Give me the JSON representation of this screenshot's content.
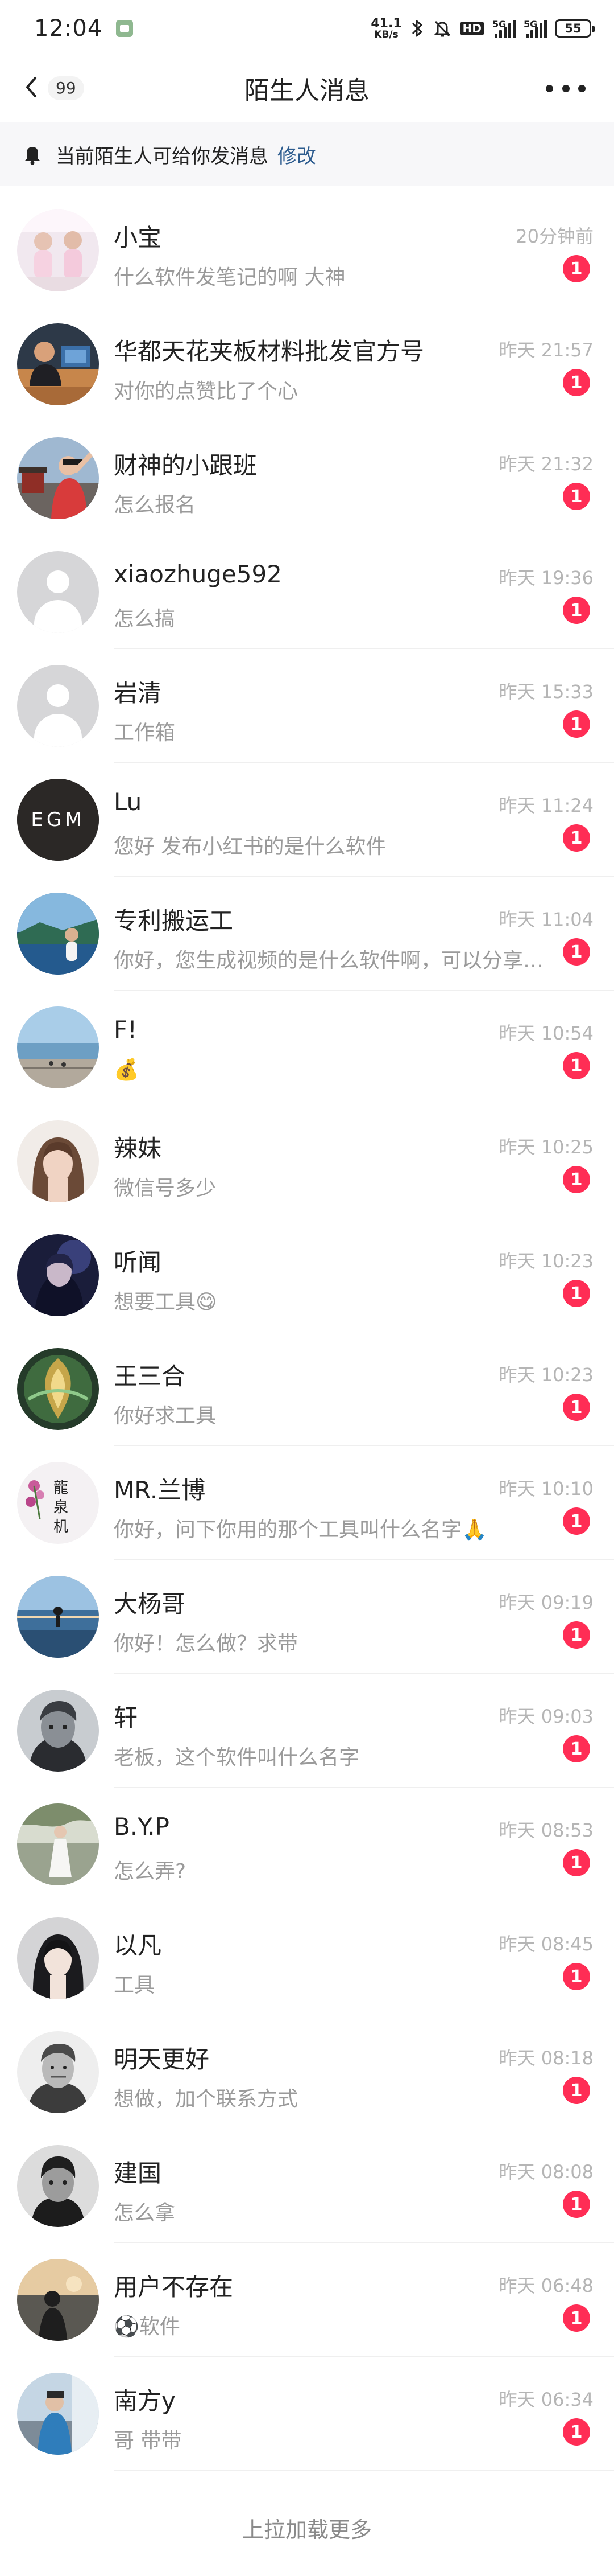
{
  "status_bar": {
    "time": "12:04",
    "net_speed_value": "41.1",
    "net_speed_unit": "KB/s",
    "hd_label": "HD",
    "signal_1_label": "5G",
    "signal_2_label": "5G",
    "battery": "55"
  },
  "nav": {
    "unread_count": "99",
    "title": "陌生人消息"
  },
  "notice": {
    "text": "当前陌生人可给你发消息",
    "link": "修改"
  },
  "messages": [
    {
      "name": "小宝",
      "preview": "什么软件发笔记的啊 大神",
      "time": "20分钟前",
      "badge": "1",
      "avatar": "av1"
    },
    {
      "name": "华都天花夹板材料批发官方号",
      "preview": "对你的点赞比了个心",
      "time": "昨天 21:57",
      "badge": "1",
      "avatar": "av2"
    },
    {
      "name": "财神的小跟班",
      "preview": "怎么报名",
      "time": "昨天 21:32",
      "badge": "1",
      "avatar": "av3"
    },
    {
      "name": "xiaozhuge592",
      "preview": "怎么搞",
      "time": "昨天 19:36",
      "badge": "1",
      "avatar": "placeholder"
    },
    {
      "name": "岩清",
      "preview": "工作箱",
      "time": "昨天 15:33",
      "badge": "1",
      "avatar": "placeholder"
    },
    {
      "name": "Lu",
      "preview": "您好 发布小红书的是什么软件",
      "time": "昨天 11:24",
      "badge": "1",
      "avatar": "av6"
    },
    {
      "name": "专利搬运工",
      "preview": "你好，您生成视频的是什么软件啊，可以分享一下吗",
      "time": "昨天 11:04",
      "badge": "1",
      "avatar": "av7"
    },
    {
      "name": "F!",
      "preview": "💰",
      "time": "昨天 10:54",
      "badge": "1",
      "avatar": "av8"
    },
    {
      "name": "辣妹",
      "preview": "微信号多少",
      "time": "昨天 10:25",
      "badge": "1",
      "avatar": "av9"
    },
    {
      "name": "听闻",
      "preview": "想要工具😋",
      "time": "昨天 10:23",
      "badge": "1",
      "avatar": "av10"
    },
    {
      "name": "王三合",
      "preview": "你好求工具",
      "time": "昨天 10:23",
      "badge": "1",
      "avatar": "av11"
    },
    {
      "name": "MR.兰博",
      "preview": "你好，问下你用的那个工具叫什么名字🙏",
      "time": "昨天 10:10",
      "badge": "1",
      "avatar": "av12"
    },
    {
      "name": "大杨哥",
      "preview": "你好！怎么做？求带",
      "time": "昨天 09:19",
      "badge": "1",
      "avatar": "av13"
    },
    {
      "name": "轩",
      "preview": "老板，这个软件叫什么名字",
      "time": "昨天 09:03",
      "badge": "1",
      "avatar": "av14"
    },
    {
      "name": "B.Y.P",
      "preview": "怎么弄?",
      "time": "昨天 08:53",
      "badge": "1",
      "avatar": "av15"
    },
    {
      "name": "以凡",
      "preview": "工具",
      "time": "昨天 08:45",
      "badge": "1",
      "avatar": "av16"
    },
    {
      "name": "明天更好",
      "preview": "想做，加个联系方式",
      "time": "昨天 08:18",
      "badge": "1",
      "avatar": "av17"
    },
    {
      "name": "建国",
      "preview": "怎么拿",
      "time": "昨天 08:08",
      "badge": "1",
      "avatar": "av18"
    },
    {
      "name": "用户不存在",
      "preview": "⚽软件",
      "time": "昨天 06:48",
      "badge": "1",
      "avatar": "av19"
    },
    {
      "name": "南方y",
      "preview": "哥 带带",
      "time": "昨天 06:34",
      "badge": "1",
      "avatar": "av20"
    }
  ],
  "avatar_text": {
    "lu": "EGM"
  },
  "footer": {
    "load_more": "上拉加载更多"
  },
  "colors": {
    "badge": "#ff2d55",
    "link": "#2d5c8f",
    "notice_bg": "#f7f7f9",
    "time": "#b5b5b5",
    "preview": "#9a9a9a"
  },
  "icons": [
    "back-arrow-icon",
    "more-dots-icon",
    "bell-icon",
    "bluetooth-icon",
    "mute-icon",
    "app-notification-icon"
  ]
}
